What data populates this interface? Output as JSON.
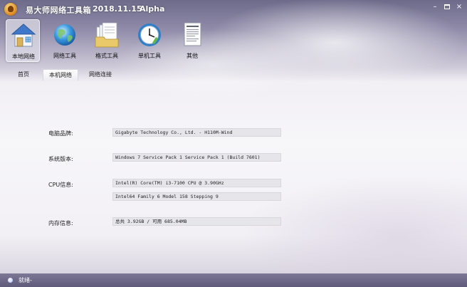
{
  "window": {
    "title": "易大师网络工具箱",
    "date": "2018.11.15",
    "version": "Alpha",
    "buttons": {
      "minimize": "–",
      "maximize": "",
      "close": "×"
    }
  },
  "toolbar": {
    "items": [
      {
        "label": "本地网络",
        "icon": "house-icon",
        "active": true
      },
      {
        "label": "网络工具",
        "icon": "globe-icon",
        "active": false
      },
      {
        "label": "格式工具",
        "icon": "folder-documents-icon",
        "active": false
      },
      {
        "label": "单机工具",
        "icon": "clock-icon",
        "active": false
      },
      {
        "label": "其他",
        "icon": "document-icon",
        "active": false
      }
    ]
  },
  "tabs": [
    {
      "label": "首页",
      "active": false
    },
    {
      "label": "本机网络",
      "active": true
    },
    {
      "label": "网络连接",
      "active": false
    }
  ],
  "info": {
    "brand": {
      "label": "电脑品牌:",
      "value": "Gigabyte Technology Co., Ltd. - H110M-Wind"
    },
    "os": {
      "label": "系统版本:",
      "value": "Windows 7 Service Pack 1 Service Pack 1 (Build 7601)"
    },
    "cpu": {
      "label": "CPU信息:",
      "value1": "Intel(R) Core(TM) i3-7100 CPU @ 3.90GHz",
      "value2": "Intel64 Family 6 Model 158 Stepping 9"
    },
    "memory": {
      "label": "内存信息:",
      "value": "总共 3.92GB / 可用 685.04MB"
    }
  },
  "status": {
    "text": "就绪-"
  },
  "colors": {
    "titlebar": "#6d6a8a",
    "statusbar": "#5f5a7a",
    "field_bg": "#e6e5ea"
  }
}
